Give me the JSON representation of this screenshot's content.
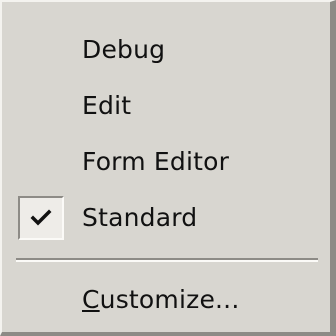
{
  "menu": {
    "items": [
      {
        "label": "Debug",
        "checked": false
      },
      {
        "label": "Edit",
        "checked": false
      },
      {
        "label": "Form Editor",
        "checked": false
      },
      {
        "label": "Standard",
        "checked": true
      }
    ],
    "customize": {
      "mnemonic": "C",
      "rest": "ustomize..."
    },
    "check_icon": "checkmark-icon"
  }
}
